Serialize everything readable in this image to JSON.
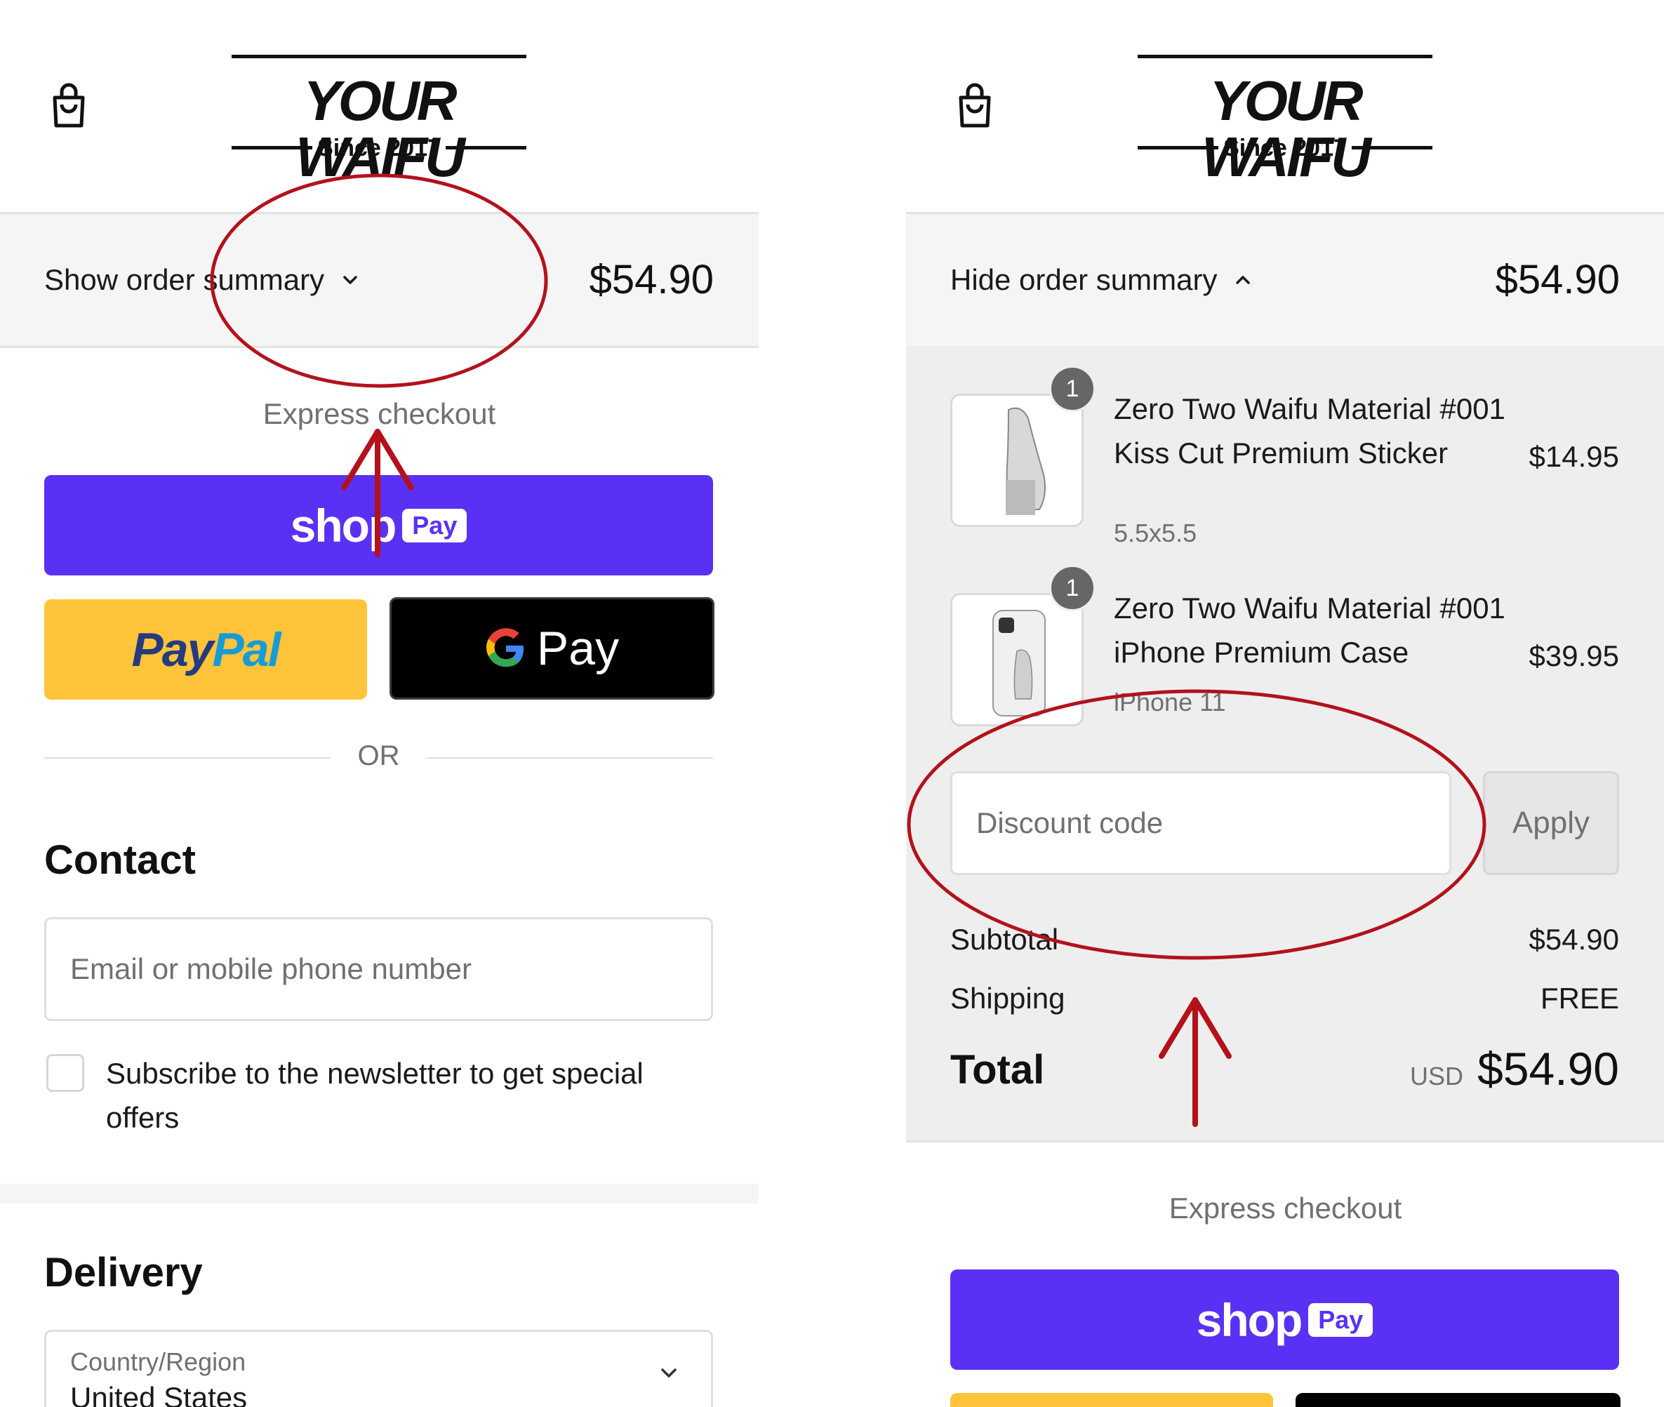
{
  "brand": {
    "name": "YOUR WAIFU",
    "tagline": "Since 2017"
  },
  "left": {
    "summary_toggle": "Show order summary",
    "summary_total": "$54.90",
    "express_label": "Express checkout",
    "shop_pay": {
      "word": "shop",
      "badge": "Pay"
    },
    "paypal": {
      "part1": "Pay",
      "part2": "Pal"
    },
    "gpay": {
      "word": "Pay"
    },
    "or_text": "OR",
    "contact_title": "Contact",
    "email_placeholder": "Email or mobile phone number",
    "newsletter_label": "Subscribe to the newsletter to get special offers",
    "delivery_title": "Delivery",
    "country": {
      "label": "Country/Region",
      "value": "United States"
    }
  },
  "right": {
    "summary_toggle": "Hide order summary",
    "summary_total": "$54.90",
    "items": [
      {
        "qty": "1",
        "title": "Zero Two Waifu Material #001 Kiss Cut Premium Sticker",
        "variant": "5.5x5.5",
        "price": "$14.95"
      },
      {
        "qty": "1",
        "title": "Zero Two Waifu Material #001 iPhone Premium Case",
        "variant": "iPhone 11",
        "price": "$39.95"
      }
    ],
    "discount_placeholder": "Discount code",
    "apply_label": "Apply",
    "subtotal_label": "Subtotal",
    "subtotal_value": "$54.90",
    "shipping_label": "Shipping",
    "shipping_value": "FREE",
    "total_label": "Total",
    "currency": "USD",
    "total_value": "$54.90",
    "express_label": "Express checkout",
    "shop_pay": {
      "word": "shop",
      "badge": "Pay"
    }
  },
  "colors": {
    "shop_pay": "#5a31f4",
    "paypal": "#ffc439",
    "annotation": "#b3121b"
  }
}
